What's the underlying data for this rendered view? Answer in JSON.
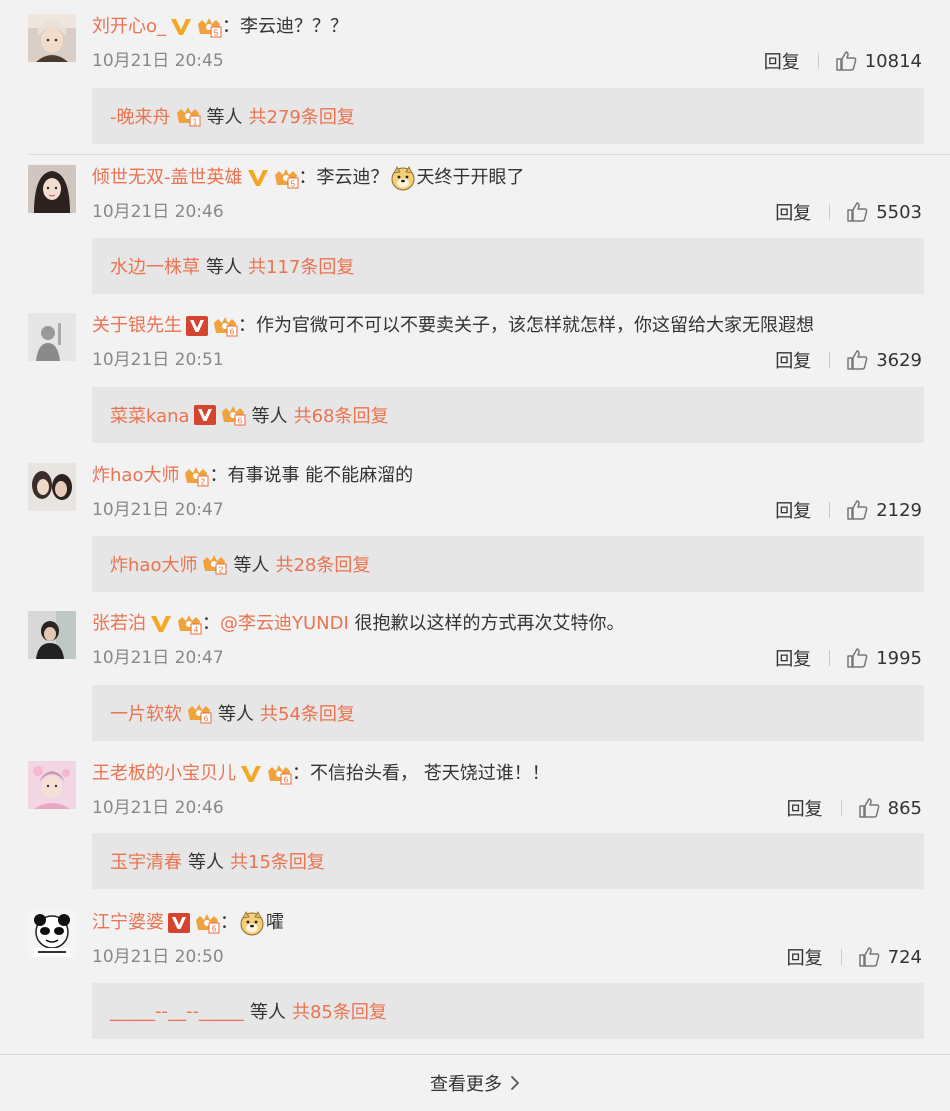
{
  "comments": [
    {
      "user": "刘开心o_",
      "v_badge": "orange",
      "member_badge": "5",
      "text": "李云迪？？？",
      "time": "10月21日 20:45",
      "reply_label": "回复",
      "likes": "10814",
      "reply_summary": {
        "user": "-晚来舟",
        "user_badge": "1",
        "people": "等人",
        "total": "共279条回复"
      }
    },
    {
      "user": "倾世无双-盖世英雄",
      "v_badge": "orange",
      "member_badge": "5",
      "text_before": "李云迪？",
      "emoji": "doge",
      "text_after": "天终于开眼了",
      "time": "10月21日 20:46",
      "reply_label": "回复",
      "likes": "5503",
      "reply_summary": {
        "user": "水边一株草",
        "people": "等人",
        "total": "共117条回复"
      }
    },
    {
      "user": "关于银先生",
      "v_badge": "red",
      "member_badge": "6",
      "text": "作为官微可不可以不要卖关子，该怎样就怎样，你这留给大家无限遐想",
      "time": "10月21日 20:51",
      "reply_label": "回复",
      "likes": "3629",
      "reply_summary": {
        "user": "菜菜kana",
        "user_v_badge": "red",
        "user_badge": "6",
        "people": "等人",
        "total": "共68条回复"
      }
    },
    {
      "user": "炸hao大师",
      "member_badge": "2",
      "text": "有事说事 能不能麻溜的",
      "time": "10月21日 20:47",
      "reply_label": "回复",
      "likes": "2129",
      "reply_summary": {
        "user": "炸hao大师",
        "user_badge": "2",
        "people": "等人",
        "total": "共28条回复"
      }
    },
    {
      "user": "张若泊",
      "v_badge": "orange",
      "member_badge": "4",
      "mention": "@李云迪YUNDI",
      "text": " 很抱歉以这样的方式再次艾特你。",
      "time": "10月21日 20:47",
      "reply_label": "回复",
      "likes": "1995",
      "reply_summary": {
        "user": "一片软软",
        "user_badge": "6",
        "people": "等人",
        "total": "共54条回复"
      }
    },
    {
      "user": "王老板的小宝贝儿",
      "v_badge": "orange",
      "member_badge": "6",
      "text": "不信抬头看， 苍天饶过谁！！",
      "time": "10月21日 20:46",
      "reply_label": "回复",
      "likes": "865",
      "reply_summary": {
        "user": "玉宇清春",
        "people": "等人",
        "total": "共15条回复"
      }
    },
    {
      "user": "江宁婆婆",
      "v_badge": "red",
      "member_badge": "6",
      "emoji": "doge",
      "text_after": "嚯",
      "time": "10月21日 20:50",
      "reply_label": "回复",
      "likes": "724",
      "reply_summary": {
        "user": "_____--__--_____",
        "people": "等人",
        "total": "共85条回复"
      }
    }
  ],
  "footer": {
    "more_label": "查看更多"
  },
  "colors": {
    "link": "#eb7350",
    "reply_bg": "#e6e6e6",
    "page_bg": "#f2f2f2",
    "v_orange": "#f5a623",
    "v_red": "#d4442e"
  }
}
